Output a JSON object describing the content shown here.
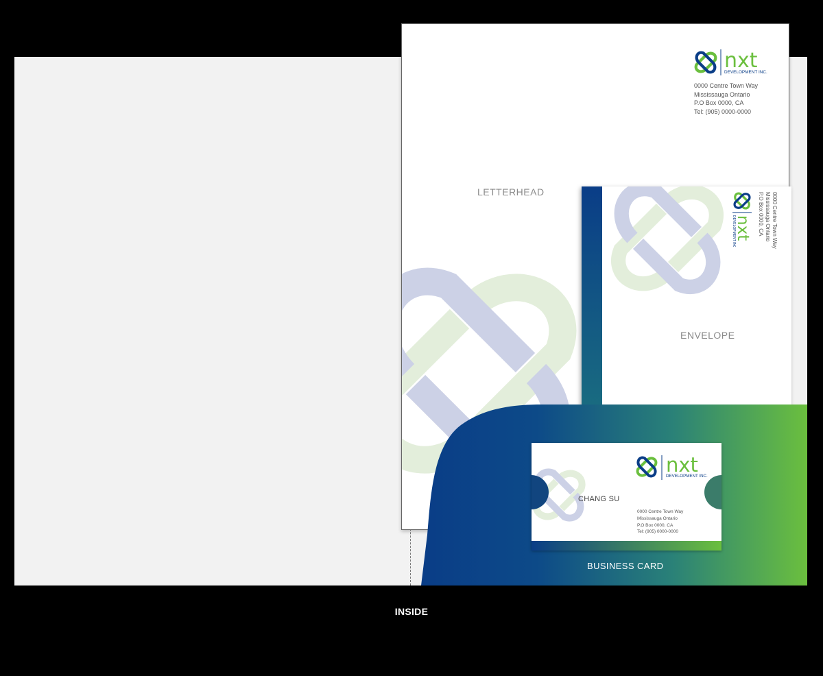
{
  "colors": {
    "background": "#000000",
    "panel": "#f2f2f2",
    "brand_blue": "#0a3d87",
    "brand_green": "#6bbf3e"
  },
  "brand": {
    "logo_text": "nxt",
    "logo_subtitle": "DEVELOPMENT INC.",
    "icon": "knot-logo-icon"
  },
  "letterhead": {
    "label": "LETTERHEAD",
    "address": [
      "0000 Centre Town Way",
      "Mississauga Ontario",
      "P.O Box 0000, CA",
      "Tel: (905) 0000-0000"
    ]
  },
  "envelope": {
    "label": "ENVELOPE",
    "address": [
      "0000 Centre Town Way",
      "Mississauga Ontario",
      "P.O Box 0000, CA"
    ]
  },
  "business_card": {
    "label": "BUSINESS CARD",
    "name": "CHANG SU",
    "address": [
      "0000 Centre Town Way",
      "Mississauga Ontario",
      "P.O Box 0000, CA",
      "Tel: (905) 0000-0000"
    ]
  },
  "caption": "INSIDE"
}
